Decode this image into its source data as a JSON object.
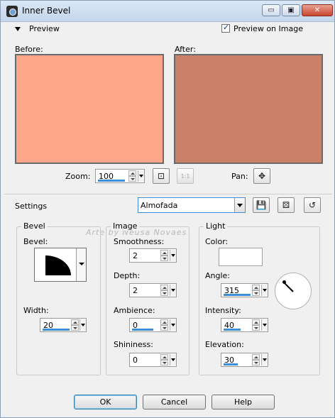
{
  "window": {
    "title": "Inner Bevel",
    "minimize_glyph": "▭",
    "maximize_glyph": "▣",
    "close_glyph": "✕"
  },
  "preview": {
    "label": "Preview",
    "preview_on_image_label": "Preview on Image",
    "preview_on_image_checked": true,
    "before_label": "Before:",
    "after_label": "After:",
    "before_color": "#ffa58a",
    "after_color": "#c98068",
    "zoom_label": "Zoom:",
    "zoom_value": "100",
    "pan_label": "Pan:",
    "fit_icon_glyph": "⊡",
    "actual_size_glyph": "1:1",
    "pan_icon_glyph": "✥"
  },
  "settings": {
    "label": "Settings",
    "preset_value": "Almofada",
    "save_icon_glyph": "💾",
    "randomize_icon_glyph": "⚄",
    "reset_icon_glyph": "↺"
  },
  "watermark": "Arte by Neusa Novaes",
  "bevel": {
    "title": "Bevel",
    "bevel_label": "Bevel:",
    "width_label": "Width:",
    "width_value": "20"
  },
  "image": {
    "title": "Image",
    "smoothness_label": "Smoothness:",
    "smoothness_value": "2",
    "depth_label": "Depth:",
    "depth_value": "2",
    "ambience_label": "Ambience:",
    "ambience_value": "0",
    "shininess_label": "Shininess:",
    "shininess_value": "0"
  },
  "light": {
    "title": "Light",
    "color_label": "Color:",
    "color_value": "#ffffff",
    "angle_label": "Angle:",
    "angle_value": "315",
    "intensity_label": "Intensity:",
    "intensity_value": "40",
    "elevation_label": "Elevation:",
    "elevation_value": "30"
  },
  "buttons": {
    "ok": "OK",
    "cancel": "Cancel",
    "help": "Help"
  }
}
